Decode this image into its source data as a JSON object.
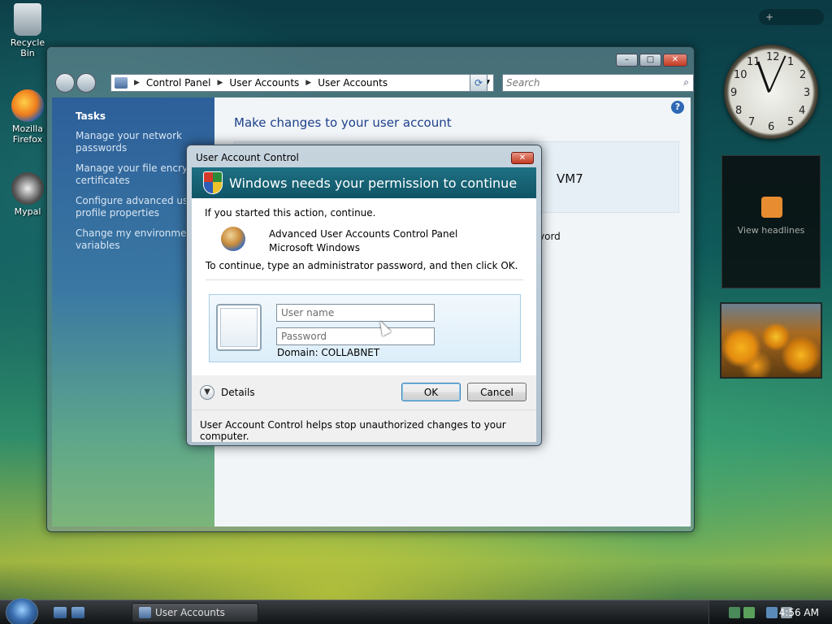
{
  "desktop": {
    "icons": [
      {
        "label": "Recycle Bin",
        "icon": "recycle-bin-icon"
      },
      {
        "label": "Mozilla Firefox",
        "icon": "firefox-icon"
      },
      {
        "label": "Mypal",
        "icon": "mypal-icon"
      }
    ]
  },
  "explorer": {
    "window_controls": {
      "minimize": "–",
      "maximize": "□",
      "close": "✕"
    },
    "breadcrumbs": [
      "Control Panel",
      "User Accounts",
      "User Accounts"
    ],
    "search_placeholder": "Search",
    "tasks_heading": "Tasks",
    "tasks": [
      "Manage your network\npasswords",
      "Manage your file encrypti\ncertificates",
      "Configure advanced user\nprofile properties",
      "Change my environment\nvariables"
    ],
    "content_title": "Make changes to your user account",
    "account_name": "VM7",
    "partial_text": "vord"
  },
  "gadgets": {
    "add_label": "+",
    "feed_label": "View headlines"
  },
  "uac": {
    "title": "User Account Control",
    "banner": "Windows needs your permission to continue",
    "line1": "If you started this action, continue.",
    "program_name": "Advanced User Accounts Control Panel",
    "publisher": "Microsoft Windows",
    "line2": "To continue, type an administrator password, and then click OK.",
    "username_placeholder": "User name",
    "password_placeholder": "Password",
    "domain": "Domain: COLLABNET",
    "details": "Details",
    "ok": "OK",
    "cancel": "Cancel",
    "footer_note": "User Account Control helps stop unauthorized changes to your computer."
  },
  "taskbar": {
    "task_button": "User Accounts",
    "time": "4:56 AM"
  },
  "clock_face": {
    "numbers": [
      "12",
      "1",
      "2",
      "3",
      "4",
      "5",
      "6",
      "7",
      "8",
      "9",
      "10",
      "11"
    ]
  }
}
